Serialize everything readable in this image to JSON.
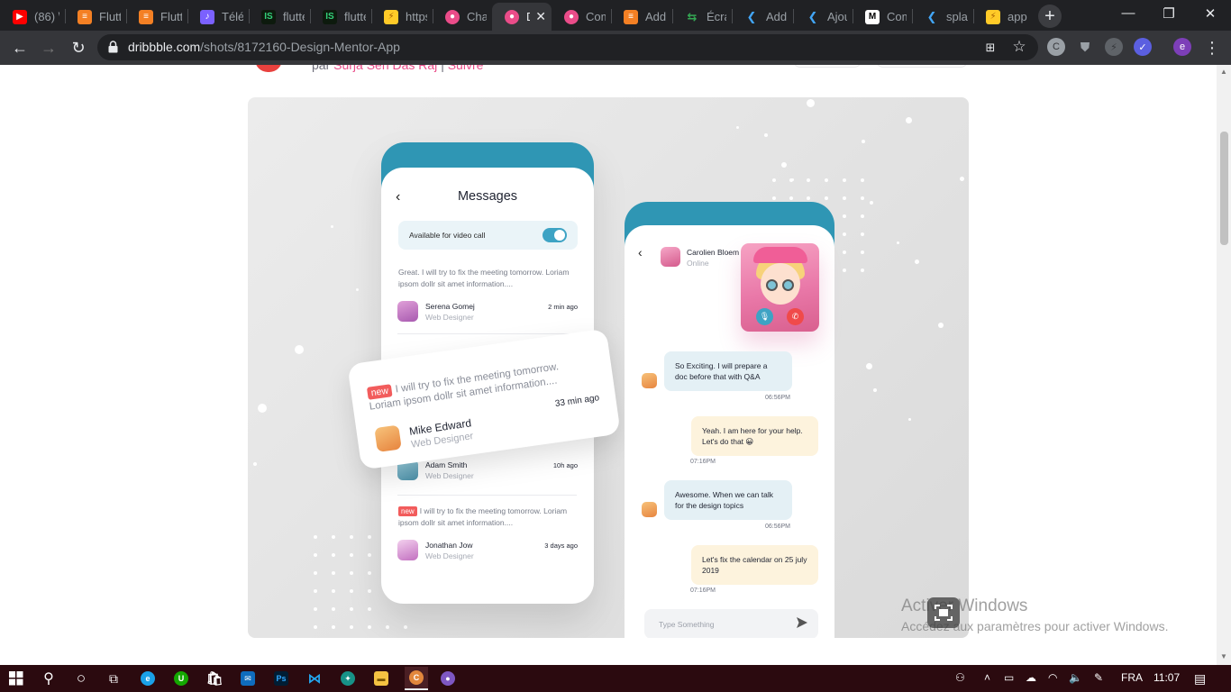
{
  "browser": {
    "tabs": [
      {
        "title": "(86) \\",
        "favicon": "youtube-icon",
        "color": "#ff0000"
      },
      {
        "title": "Flutte",
        "favicon": "stackoverflow-icon",
        "color": "#f48024"
      },
      {
        "title": "Flutte",
        "favicon": "stackoverflow-icon",
        "color": "#f48024"
      },
      {
        "title": "Téléc",
        "favicon": "app-icon",
        "color": "#7b61ff"
      },
      {
        "title": "flutte",
        "favicon": "pub-icon",
        "color": "#0a8f3c"
      },
      {
        "title": "flutte",
        "favicon": "pub-icon",
        "color": "#0a8f3c"
      },
      {
        "title": "https",
        "favicon": "firebase-icon",
        "color": "#ffca28"
      },
      {
        "title": "Chat",
        "favicon": "dribbble-icon",
        "color": "#ea4c89"
      },
      {
        "title": "D",
        "favicon": "dribbble-icon",
        "color": "#ea4c89"
      },
      {
        "title": "Com",
        "favicon": "dribbble-icon",
        "color": "#ea4c89"
      },
      {
        "title": "Addi",
        "favicon": "stackoverflow-icon",
        "color": "#f48024"
      },
      {
        "title": "Écran",
        "favicon": "link-icon",
        "color": "#34a853"
      },
      {
        "title": "Addi",
        "favicon": "flutter-icon",
        "color": "#42a5f5"
      },
      {
        "title": "Ajou",
        "favicon": "flutter-icon",
        "color": "#42a5f5"
      },
      {
        "title": "Com",
        "favicon": "medium-icon",
        "color": "#000000"
      },
      {
        "title": "splas",
        "favicon": "flutter-icon",
        "color": "#42a5f5"
      },
      {
        "title": "apps",
        "favicon": "firebase-icon",
        "color": "#ffca28"
      }
    ],
    "active_tab_index": 8,
    "url_host": "dribbble.com",
    "url_path": "/shots/8172160-Design-Mentor-App",
    "profile_initial": "e"
  },
  "page": {
    "byline_prefix": "par",
    "byline_author": "Surja Sen Das Raj",
    "byline_separator": "|",
    "byline_action": "Suivre",
    "shot": {
      "messages_title": "Messages",
      "video_call_label": "Available for video call",
      "video_call_enabled": true,
      "new_badge": "new",
      "conversations": [
        {
          "preview": "Great. I will try to fix the meeting tomorrow. Loriam ipsom dollr sit amet information....",
          "name": "Serena Gomej",
          "role": "Web Designer",
          "time": "2 min ago"
        },
        {
          "preview": "I will try to fix the meeting tomorrow. Loriam ipsom dollr sit amet information....",
          "name": "Mike Edward",
          "role": "Web Designer",
          "time": "33 min ago"
        },
        {
          "name": "Adam Smith",
          "role": "Web Designer",
          "time": "10h ago"
        },
        {
          "preview": "I will try to fix the meeting tomorrow. Loriam ipsom dollr sit amet information....",
          "name": "Jonathan Jow",
          "role": "Web Designer",
          "time": "3 days ago"
        }
      ],
      "chat": {
        "contact_name": "Carolien Bloem",
        "contact_status": "Online",
        "messages": [
          {
            "text": "So Exciting. I will prepare a doc before that with Q&A",
            "time": "06:56PM"
          },
          {
            "text": "Yeah. I am here for your help. Let's do that 😀",
            "time": "07:16PM"
          },
          {
            "text": "Awesome. When we can talk for the design topics",
            "time": "06:56PM"
          },
          {
            "text": "Let's fix the calendar on 25 july 2019",
            "time": "07:16PM"
          }
        ],
        "input_placeholder": "Type Something"
      }
    },
    "watermark_title": "Activer Windows",
    "watermark_subtitle": "Accédez aux paramètres pour activer Windows."
  },
  "taskbar": {
    "language": "FRA",
    "time": "11:07"
  }
}
